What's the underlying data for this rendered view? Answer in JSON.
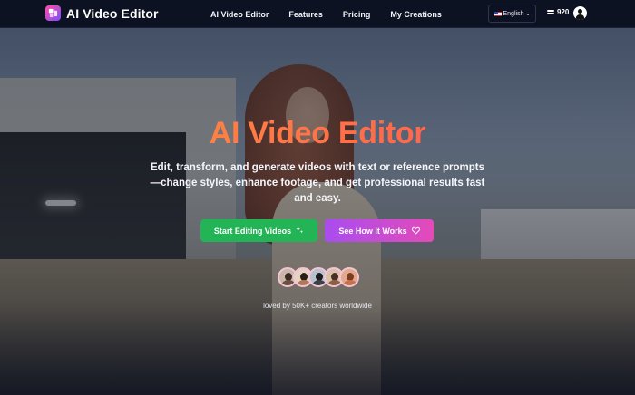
{
  "brand": {
    "name": "AI Video Editor",
    "logo_icon": "sparkle-logo-icon"
  },
  "nav": {
    "links": [
      {
        "label": "AI Video Editor"
      },
      {
        "label": "Features"
      },
      {
        "label": "Pricing"
      },
      {
        "label": "My Creations"
      }
    ],
    "language": {
      "selected": "English",
      "flag": "us-flag-icon"
    },
    "credits": {
      "count": "920",
      "icon": "coins-icon"
    },
    "user_icon": "user-avatar-icon"
  },
  "hero": {
    "title": "AI Video Editor",
    "description": "Edit, transform, and generate videos with text or reference prompts—change styles, enhance footage, and get professional results fast and easy.",
    "primary_cta": {
      "label": "Start Editing Videos",
      "icon": "sparkle-icon",
      "color": "#22b455"
    },
    "secondary_cta": {
      "label": "See How It Works",
      "icon": "heart-icon",
      "color_start": "#a94cf0",
      "color_end": "#e34bb8"
    },
    "social_proof": "loved by 50K+ creators worldwide",
    "title_gradient": [
      "#ff9a3c",
      "#ff5a55"
    ]
  }
}
